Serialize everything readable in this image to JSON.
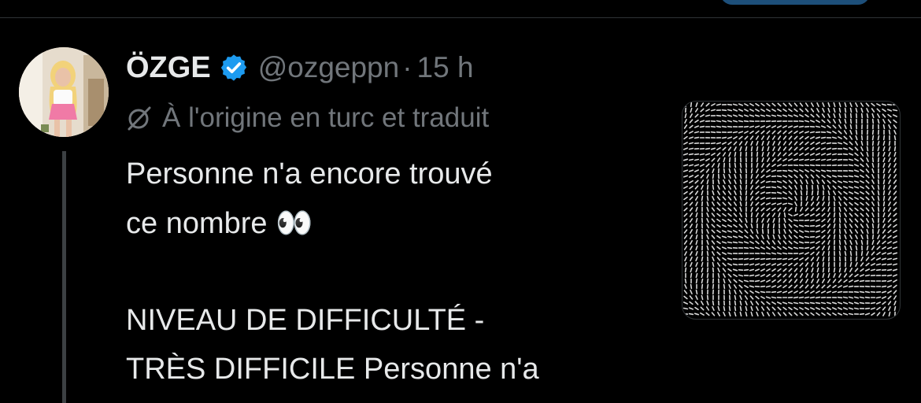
{
  "tweet": {
    "author": {
      "display_name": "ÖZGE",
      "handle": "@ozgeppn",
      "verified": true,
      "avatar_icon": "profile-photo-icon"
    },
    "separator": "·",
    "time": "15 h",
    "translation_note": "À l'origine en turc et traduit",
    "text_lines": [
      "Personne n'a encore trouvé",
      "ce nombre ",
      "",
      "NIVEAU DE DIFFICULTÉ -",
      "TRÈS DIFFICILE Personne n'a"
    ],
    "emoji": "👀",
    "media_icon": "optical-illusion-image"
  },
  "colors": {
    "background": "#000000",
    "text": "#e7e9ea",
    "muted": "#71767b",
    "verified_blue": "#1d9bf0",
    "thread_line": "#3c4043"
  }
}
